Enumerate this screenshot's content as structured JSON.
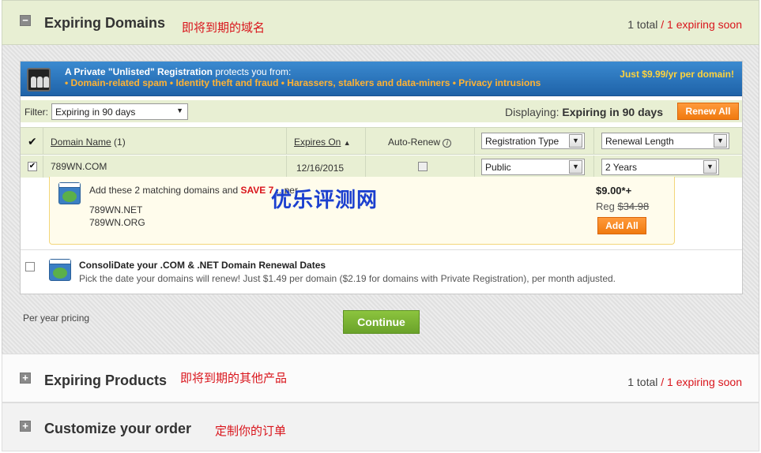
{
  "sections": {
    "expiring_domains": {
      "title": "Expiring Domains",
      "annotation": "即将到期的域名",
      "total": "1 total",
      "sep": " / ",
      "soon": "1 expiring soon"
    },
    "expiring_products": {
      "title": "Expiring Products",
      "annotation": "即将到期的其他产品",
      "total": "1 total",
      "sep": " / ",
      "soon": "1 expiring soon"
    },
    "customize_order": {
      "title": "Customize your order",
      "annotation": "定制你的订单"
    }
  },
  "banner": {
    "heading_bold": "A Private \"Unlisted\" Registration",
    "heading_rest": " protects you from:",
    "threats": "• Domain-related spam  • Identity theft and fraud  • Harassers, stalkers and data-miners  • Privacy intrusions",
    "price": "Just $9.99/yr per domain!"
  },
  "filter": {
    "label": "Filter:",
    "value": "Expiring in 90 days",
    "displaying_label": "Displaying:",
    "displaying_value": "Expiring in 90 days",
    "renew_all": "Renew All"
  },
  "table": {
    "headers": {
      "domain_name": "Domain Name",
      "domain_count": " (1)",
      "expires_on": "Expires On",
      "auto_renew": "Auto-Renew",
      "registration_type": "Registration Type",
      "renewal_length": "Renewal Length"
    },
    "rows": [
      {
        "domain": "789WN.COM",
        "expires": "12/16/2015",
        "registration": "Public",
        "renewal": "2 Years"
      }
    ]
  },
  "suggestion": {
    "text_pre": "Add these 2 matching domains and ",
    "save": "SAVE 7",
    "text_post": "  ...per",
    "domains": [
      "789WN.NET",
      "789WN.ORG"
    ],
    "price": "$9.00*+",
    "reg_label": "Reg ",
    "reg_price": "$34.98",
    "add_all": "Add All"
  },
  "consolidate": {
    "title": "ConsoliDate your .COM & .NET Domain Renewal Dates",
    "desc": "Pick the date your domains will renew! Just $1.49 per domain ($2.19 for domains with Private Registration), per month adjusted."
  },
  "footer": {
    "per_year": "Per year pricing",
    "continue": "Continue"
  },
  "watermark": "优乐评测网"
}
